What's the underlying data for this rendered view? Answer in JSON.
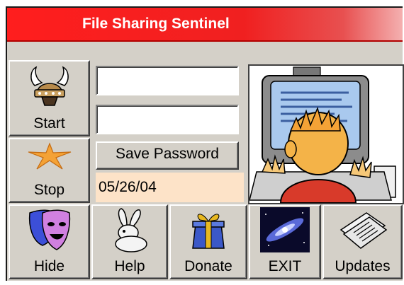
{
  "window": {
    "title": "File Sharing Sentinel"
  },
  "inputs": {
    "field1": {
      "value": ""
    },
    "field2": {
      "value": ""
    }
  },
  "controls": {
    "start_label": "Start",
    "stop_label": "Stop",
    "save_password_label": "Save Password",
    "date": "05/26/04"
  },
  "toolbar": {
    "hide_label": "Hide",
    "help_label": "Help",
    "donate_label": "Donate",
    "exit_label": "EXIT",
    "updates_label": "Updates"
  },
  "icons": {
    "start": "viking-helmet-icon",
    "stop": "starfish-icon",
    "hide": "theater-masks-icon",
    "help": "rabbit-icon",
    "donate": "gift-box-icon",
    "exit": "galaxy-icon",
    "updates": "newspaper-icon",
    "illustration": "person-at-computer-illustration"
  },
  "colors": {
    "titlebar": "#ff1e1e",
    "date_background": "#fde3c8",
    "face": "#d4d0c8"
  }
}
